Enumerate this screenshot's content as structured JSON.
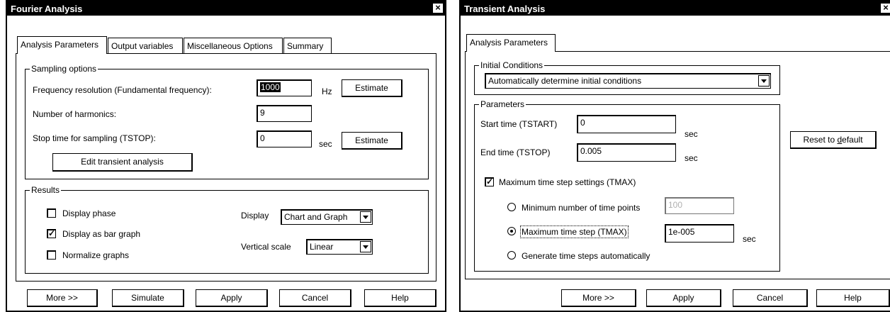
{
  "fourier": {
    "title": "Fourier Analysis",
    "close": "×",
    "tabs": [
      "Analysis Parameters",
      "Output variables",
      "Miscellaneous Options",
      "Summary"
    ],
    "sampling": {
      "group": "Sampling options",
      "freq_label": "Frequency resolution (Fundamental frequency):",
      "freq_value": "1000",
      "freq_unit": "Hz",
      "estimate1": "Estimate",
      "harmonics_label": "Number of harmonics:",
      "harmonics_value": "9",
      "stop_label": "Stop time for sampling (TSTOP):",
      "stop_value": "0",
      "stop_unit": "sec",
      "estimate2": "Estimate",
      "edit_transient": "Edit transient analysis"
    },
    "results": {
      "group": "Results",
      "display_phase": "Display phase",
      "display_phase_checked": false,
      "bar_graph": "Display as bar graph",
      "bar_graph_checked": true,
      "normalize": "Normalize graphs",
      "normalize_checked": false,
      "display_label": "Display",
      "display_value": "Chart and Graph",
      "vscale_label": "Vertical scale",
      "vscale_value": "Linear"
    },
    "buttons": {
      "more": "More >>",
      "simulate": "Simulate",
      "apply": "Apply",
      "cancel": "Cancel",
      "help": "Help"
    }
  },
  "transient": {
    "title": "Transient Analysis",
    "close": "×",
    "tabs": [
      "Analysis Parameters"
    ],
    "initial": {
      "group": "Initial Conditions",
      "value": "Automatically determine initial conditions"
    },
    "params": {
      "group": "Parameters",
      "start_label": "Start time (TSTART)",
      "start_value": "0",
      "start_unit": "sec",
      "end_label": "End time (TSTOP)",
      "end_value": "0.005",
      "end_unit": "sec",
      "reset_pre": "Reset to ",
      "reset_ul": "d",
      "reset_post": "efault",
      "tmax_label": "Maximum time step settings (TMAX)",
      "tmax_checked": true,
      "min_points_label": "Minimum number of time points",
      "min_points_value": "100",
      "max_step_label": "Maximum time step (TMAX)",
      "max_step_value": "1e-005",
      "max_step_unit": "sec",
      "auto_label": "Generate time steps automatically",
      "selected_option": "max_step"
    },
    "buttons": {
      "more": "More >>",
      "apply": "Apply",
      "cancel": "Cancel",
      "help": "Help"
    }
  }
}
